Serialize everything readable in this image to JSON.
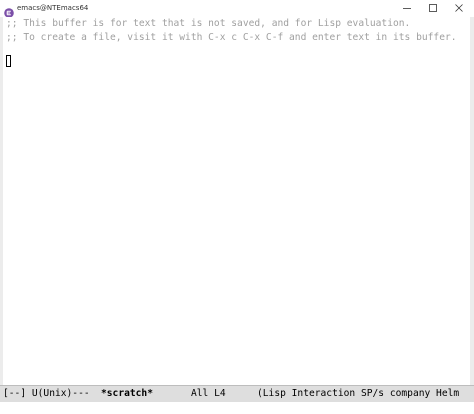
{
  "window": {
    "title": "emacs@NTEmacs64",
    "icon": "emacs-icon",
    "controls": {
      "minimize_icon": "minimize-icon",
      "maximize_icon": "maximize-icon",
      "close_icon": "close-icon"
    }
  },
  "buffer": {
    "lines": [
      ";; This buffer is for text that is not saved, and for Lisp evaluation.",
      ";; To create a file, visit it with C-x c C-x C-f and enter text in its buffer."
    ]
  },
  "mode_line": {
    "status": "[--] U(Unix)---",
    "buffer_name": "*scratch*",
    "position": "All L4",
    "modes": "(Lisp Interaction SP/s company Helm"
  },
  "colors": {
    "comment_text": "#a0a0a0",
    "mode_line_bg": "#dedede",
    "emacs_icon": "#7b4fa8"
  }
}
